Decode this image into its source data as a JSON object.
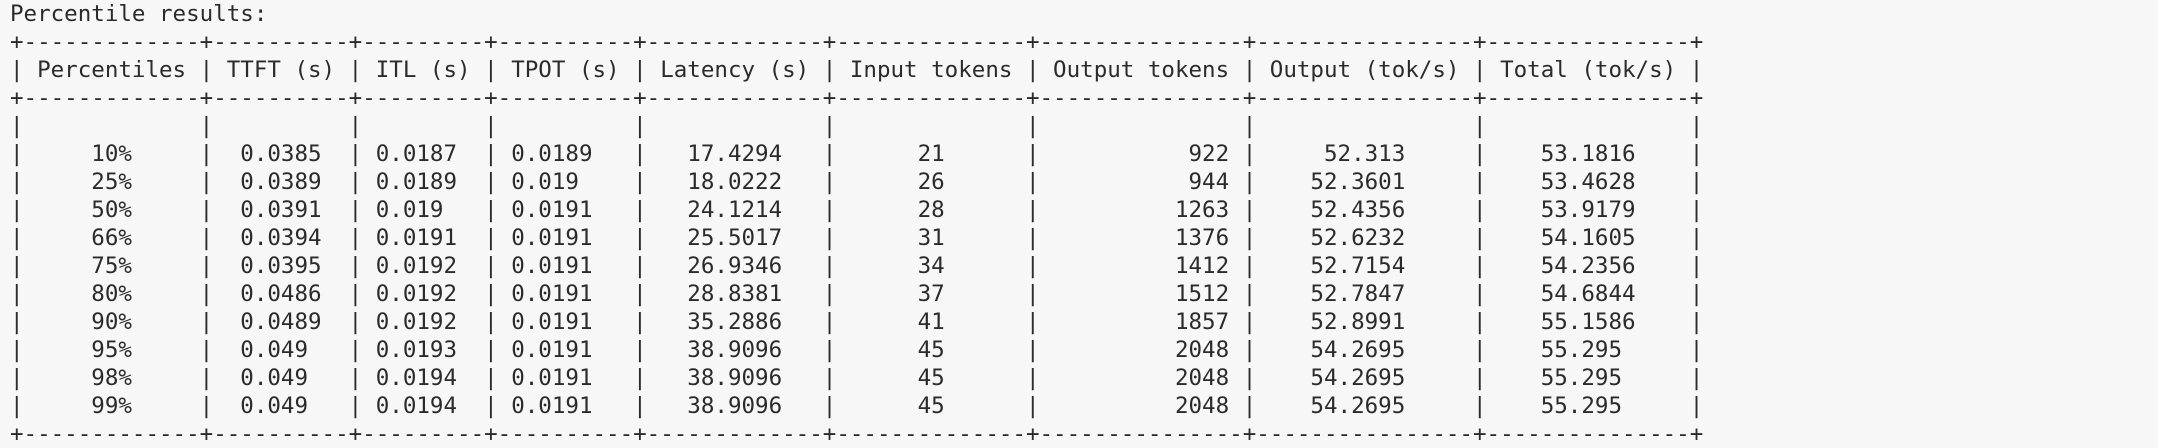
{
  "terminal": {
    "heading": "Percentile results:",
    "columns": [
      {
        "label": "Percentiles",
        "width": 13,
        "align": "center"
      },
      {
        "label": "TTFT (s)",
        "width": 10,
        "align": "center"
      },
      {
        "label": "ITL (s)",
        "width": 9,
        "align": "left"
      },
      {
        "label": "TPOT (s)",
        "width": 10,
        "align": "left"
      },
      {
        "label": "Latency (s)",
        "width": 13,
        "align": "center"
      },
      {
        "label": "Input tokens",
        "width": 14,
        "align": "center"
      },
      {
        "label": "Output tokens",
        "width": 15,
        "align": "right"
      },
      {
        "label": "Output (tok/s)",
        "width": 16,
        "align": "center"
      },
      {
        "label": "Total (tok/s)",
        "width": 15,
        "align": "center"
      }
    ],
    "rows": [
      [
        "10%",
        "0.0385",
        "0.0187",
        "0.0189",
        "17.4294",
        "21",
        "922",
        "52.313",
        "53.1816"
      ],
      [
        "25%",
        "0.0389",
        "0.0189",
        "0.019",
        "18.0222",
        "26",
        "944",
        "52.3601",
        "53.4628"
      ],
      [
        "50%",
        "0.0391",
        "0.019",
        "0.0191",
        "24.1214",
        "28",
        "1263",
        "52.4356",
        "53.9179"
      ],
      [
        "66%",
        "0.0394",
        "0.0191",
        "0.0191",
        "25.5017",
        "31",
        "1376",
        "52.6232",
        "54.1605"
      ],
      [
        "75%",
        "0.0395",
        "0.0192",
        "0.0191",
        "26.9346",
        "34",
        "1412",
        "52.7154",
        "54.2356"
      ],
      [
        "80%",
        "0.0486",
        "0.0192",
        "0.0191",
        "28.8381",
        "37",
        "1512",
        "52.7847",
        "54.6844"
      ],
      [
        "90%",
        "0.0489",
        "0.0192",
        "0.0191",
        "35.2886",
        "41",
        "1857",
        "52.8991",
        "55.1586"
      ],
      [
        "95%",
        "0.049",
        "0.0193",
        "0.0191",
        "38.9096",
        "45",
        "2048",
        "54.2695",
        "55.295"
      ],
      [
        "98%",
        "0.049",
        "0.0194",
        "0.0191",
        "38.9096",
        "45",
        "2048",
        "54.2695",
        "55.295"
      ],
      [
        "99%",
        "0.049",
        "0.0194",
        "0.0191",
        "38.9096",
        "45",
        "2048",
        "54.2695",
        "55.295"
      ]
    ]
  }
}
